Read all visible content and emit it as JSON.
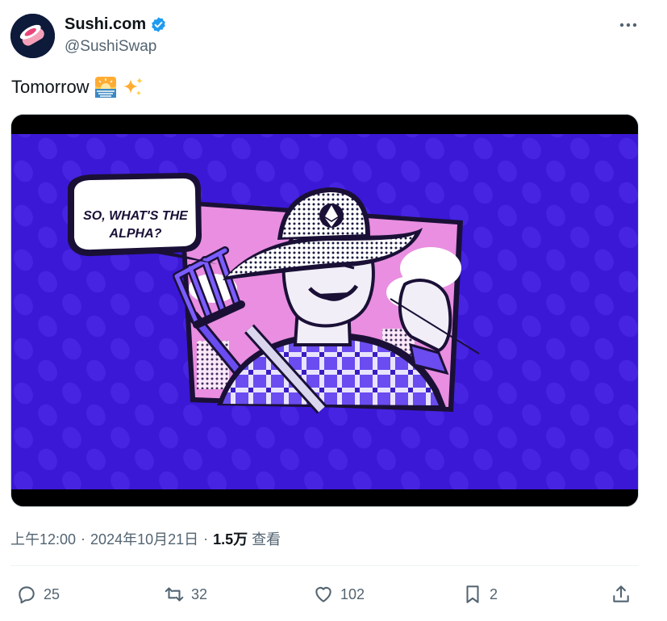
{
  "author": {
    "display_name": "Sushi.com",
    "handle": "@SushiSwap",
    "verified": true,
    "avatar_icon": "sushi-roll-logo-icon"
  },
  "tweet": {
    "text": "Tomorrow",
    "emojis": [
      "sunrise-over-sea-emoji",
      "sparkles-emoji"
    ]
  },
  "media": {
    "speech_bubble_line1": "SO, WHAT'S THE",
    "speech_bubble_line2": "ALPHA?",
    "background_color": "#3b18d6",
    "panel_pink": "#e98ee0",
    "illustration": "farmer-with-ethereum-hat-and-pitchfork"
  },
  "meta": {
    "time": "上午12:00",
    "date": "2024年10月21日",
    "views_count": "1.5万",
    "views_label": "查看"
  },
  "actions": {
    "replies": "25",
    "retweets": "32",
    "likes": "102",
    "bookmarks": "2"
  },
  "colors": {
    "verified_blue": "#1d9bf0",
    "text_primary": "#0f1419",
    "text_secondary": "#536471"
  }
}
